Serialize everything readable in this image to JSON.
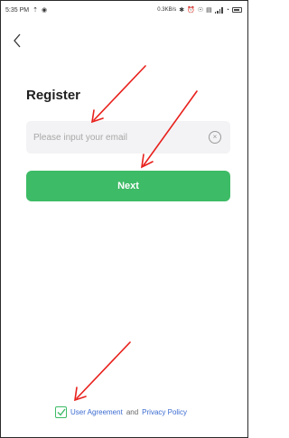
{
  "status_bar": {
    "time": "5:35 PM",
    "speed": "0.3KB/s"
  },
  "title": "Register",
  "email": {
    "value": "",
    "placeholder": "Please input your email"
  },
  "next_button": "Next",
  "agreement": {
    "user_agreement": "User Agreement",
    "and": "and",
    "privacy_policy": "Privacy Policy",
    "checked": true
  },
  "colors": {
    "accent": "#3dbb66",
    "link": "#3b6bd1",
    "annotation": "#e8201c"
  }
}
